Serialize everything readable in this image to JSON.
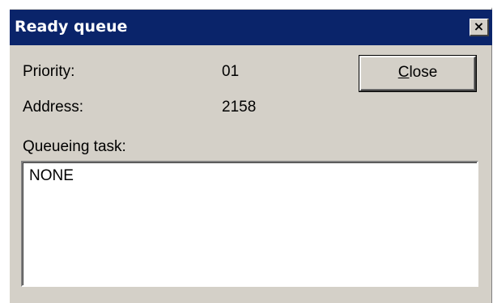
{
  "window": {
    "title": "Ready queue",
    "close_glyph": "×"
  },
  "fields": {
    "priority_label": "Priority:",
    "priority_value": "01",
    "address_label": "Address:",
    "address_value": "2158",
    "queueing_task_label": "Queueing task:"
  },
  "buttons": {
    "close_accel": "C",
    "close_rest": "lose"
  },
  "task_list": {
    "content": "NONE"
  },
  "colors": {
    "titlebar": "#0a246a",
    "dialog_face": "#d4d0c8",
    "text": "#000000",
    "listbox_bg": "#ffffff"
  }
}
